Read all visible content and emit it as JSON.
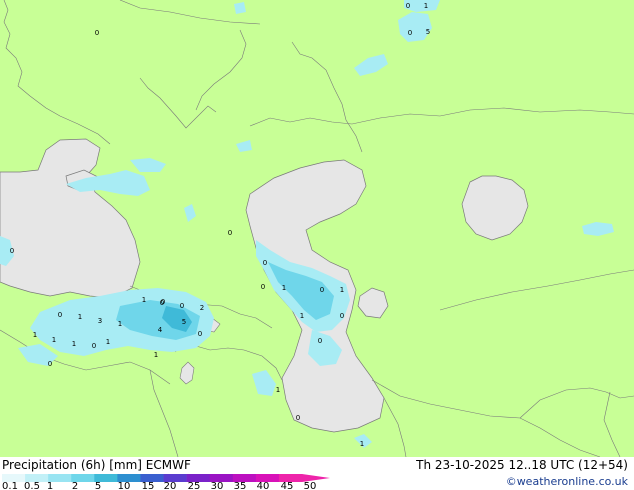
{
  "title": "Precipitation (6h) [mm] ECMWF",
  "timestamp": "Th 23-10-2025 12..18 UTC (12+54)",
  "credit": "©weatheronline.co.uk",
  "colors": {
    "land": "#c8ff96",
    "sea": "#e6e6e6",
    "coast": "#7a7a7a",
    "light_precip": "#a8ecf4",
    "mid_precip": "#6fd6ea",
    "heavy_precip": "#3fbad8"
  },
  "legend": {
    "ticks": [
      "0.1",
      "0.5",
      "1",
      "2",
      "5",
      "10",
      "15",
      "20",
      "25",
      "30",
      "35",
      "40",
      "45",
      "50"
    ],
    "colors": [
      "#e6f8fb",
      "#c2f0f7",
      "#99e4f2",
      "#6fd6ea",
      "#3fbad8",
      "#2d8fd0",
      "#3a5fcf",
      "#5a3ccf",
      "#7a22c9",
      "#9a14c4",
      "#bc10c0",
      "#d812b8",
      "#ee24aa"
    ]
  },
  "map_values": [
    "0",
    "1",
    "0",
    "5",
    "0",
    "0",
    "0",
    "0",
    "0",
    "1",
    "0",
    "1",
    "1",
    "0",
    "0",
    "2",
    "0",
    "1",
    "3",
    "1",
    "5",
    "4",
    "0",
    "1",
    "1",
    "1",
    "0",
    "1",
    "1",
    "0",
    "1",
    "0",
    "0",
    "1",
    "0",
    "1",
    "0"
  ]
}
